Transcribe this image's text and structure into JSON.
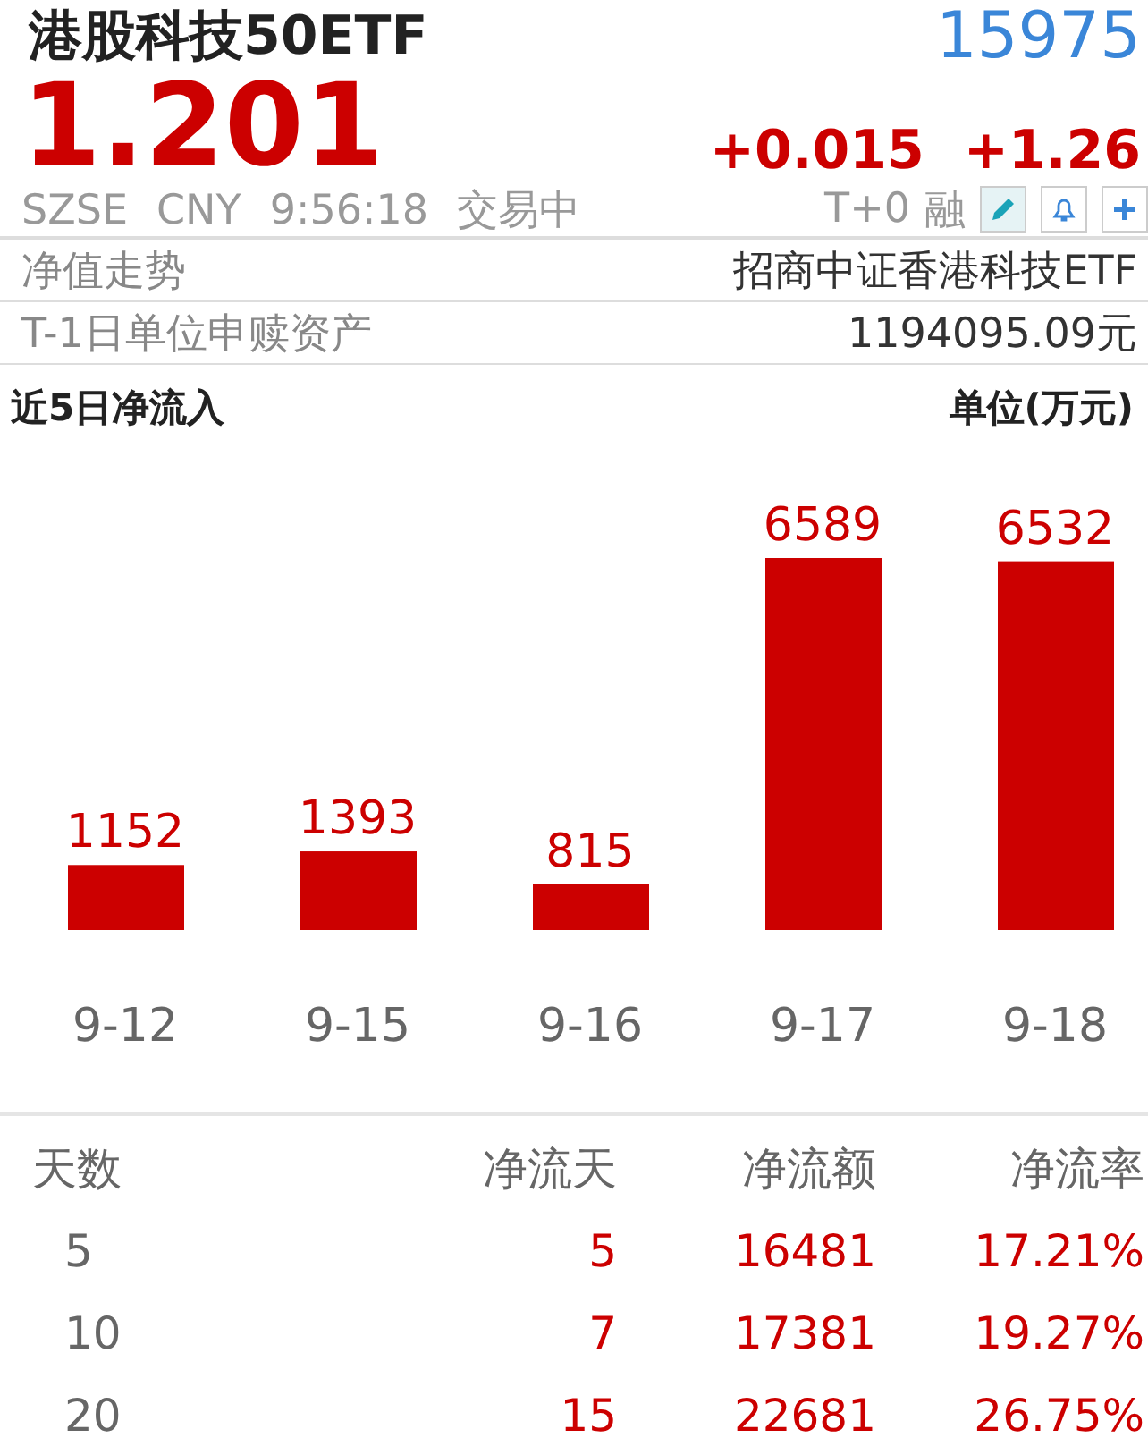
{
  "header": {
    "name": "港股科技50ETF",
    "code": "15975",
    "price": "1.201",
    "change": "+0.015",
    "change_pct": "+1.26"
  },
  "status": {
    "exchange": "SZSE",
    "currency": "CNY",
    "time": "9:56:18",
    "state": "交易中",
    "tplus": "T+0",
    "margin": "融"
  },
  "info_rows": [
    {
      "label": "净值走势",
      "value": "招商中证香港科技ETF"
    },
    {
      "label": "T-1日单位申赎资产",
      "value": "1194095.09元"
    }
  ],
  "flow": {
    "title": "近5日净流入",
    "unit": "单位(万元)",
    "chart_data": {
      "type": "bar",
      "categories": [
        "9-12",
        "9-15",
        "9-16",
        "9-17",
        "9-18"
      ],
      "series": [
        {
          "color": "#cc0000",
          "values": [
            1152,
            1393,
            815,
            6589,
            6532
          ]
        }
      ],
      "data_labels": true
    }
  },
  "table": {
    "columns": [
      "天数",
      "净流天",
      "净流额",
      "净流率"
    ],
    "rows": [
      [
        "5",
        "5",
        "16481",
        "17.21%"
      ],
      [
        "10",
        "7",
        "17381",
        "19.27%"
      ],
      [
        "20",
        "15",
        "22681",
        "26.75%"
      ]
    ]
  }
}
